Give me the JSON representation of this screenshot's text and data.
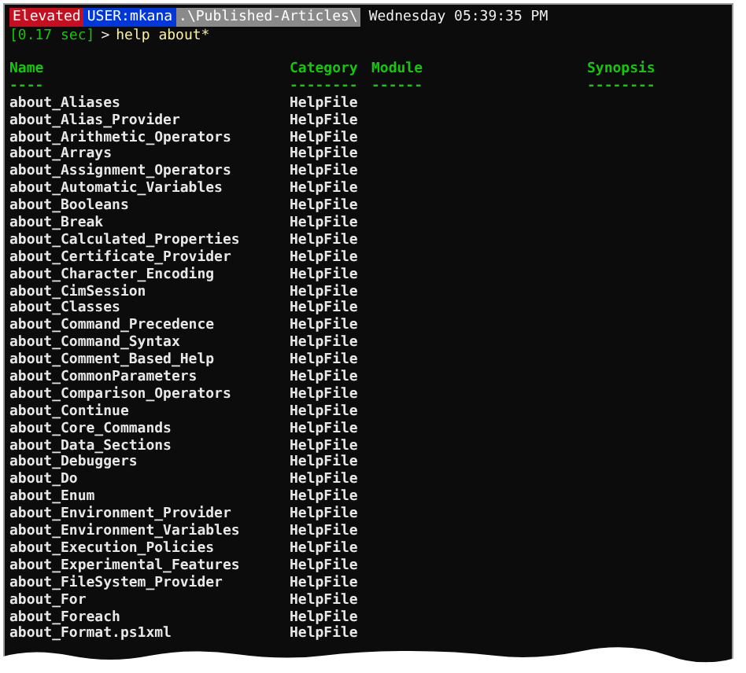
{
  "prompt": {
    "segments": [
      {
        "kind": "elevated",
        "text": "Elevated"
      },
      {
        "kind": "user",
        "text": "USER:mkana"
      },
      {
        "kind": "path",
        "text": ".\\Published-Articles\\"
      }
    ],
    "clock": "Wednesday 05:39:35 PM"
  },
  "command": {
    "timing": "[0.17 sec]",
    "symbol": ">",
    "text": "help about*"
  },
  "table": {
    "columns": [
      {
        "name": "Name",
        "rule": "----"
      },
      {
        "name": "Category",
        "rule": "--------"
      },
      {
        "name": "Module",
        "rule": "------"
      },
      {
        "name": "Synopsis",
        "rule": "--------"
      }
    ],
    "rows": [
      {
        "name": "about_Aliases",
        "category": "HelpFile"
      },
      {
        "name": "about_Alias_Provider",
        "category": "HelpFile"
      },
      {
        "name": "about_Arithmetic_Operators",
        "category": "HelpFile"
      },
      {
        "name": "about_Arrays",
        "category": "HelpFile"
      },
      {
        "name": "about_Assignment_Operators",
        "category": "HelpFile"
      },
      {
        "name": "about_Automatic_Variables",
        "category": "HelpFile"
      },
      {
        "name": "about_Booleans",
        "category": "HelpFile"
      },
      {
        "name": "about_Break",
        "category": "HelpFile"
      },
      {
        "name": "about_Calculated_Properties",
        "category": "HelpFile"
      },
      {
        "name": "about_Certificate_Provider",
        "category": "HelpFile"
      },
      {
        "name": "about_Character_Encoding",
        "category": "HelpFile"
      },
      {
        "name": "about_CimSession",
        "category": "HelpFile"
      },
      {
        "name": "about_Classes",
        "category": "HelpFile"
      },
      {
        "name": "about_Command_Precedence",
        "category": "HelpFile"
      },
      {
        "name": "about_Command_Syntax",
        "category": "HelpFile"
      },
      {
        "name": "about_Comment_Based_Help",
        "category": "HelpFile"
      },
      {
        "name": "about_CommonParameters",
        "category": "HelpFile"
      },
      {
        "name": "about_Comparison_Operators",
        "category": "HelpFile"
      },
      {
        "name": "about_Continue",
        "category": "HelpFile"
      },
      {
        "name": "about_Core_Commands",
        "category": "HelpFile"
      },
      {
        "name": "about_Data_Sections",
        "category": "HelpFile"
      },
      {
        "name": "about_Debuggers",
        "category": "HelpFile"
      },
      {
        "name": "about_Do",
        "category": "HelpFile"
      },
      {
        "name": "about_Enum",
        "category": "HelpFile"
      },
      {
        "name": "about_Environment_Provider",
        "category": "HelpFile"
      },
      {
        "name": "about_Environment_Variables",
        "category": "HelpFile"
      },
      {
        "name": "about_Execution_Policies",
        "category": "HelpFile"
      },
      {
        "name": "about_Experimental_Features",
        "category": "HelpFile"
      },
      {
        "name": "about_FileSystem_Provider",
        "category": "HelpFile"
      },
      {
        "name": "about_For",
        "category": "HelpFile"
      },
      {
        "name": "about_Foreach",
        "category": "HelpFile"
      },
      {
        "name": "about_Format.ps1xml",
        "category": "HelpFile"
      }
    ]
  }
}
